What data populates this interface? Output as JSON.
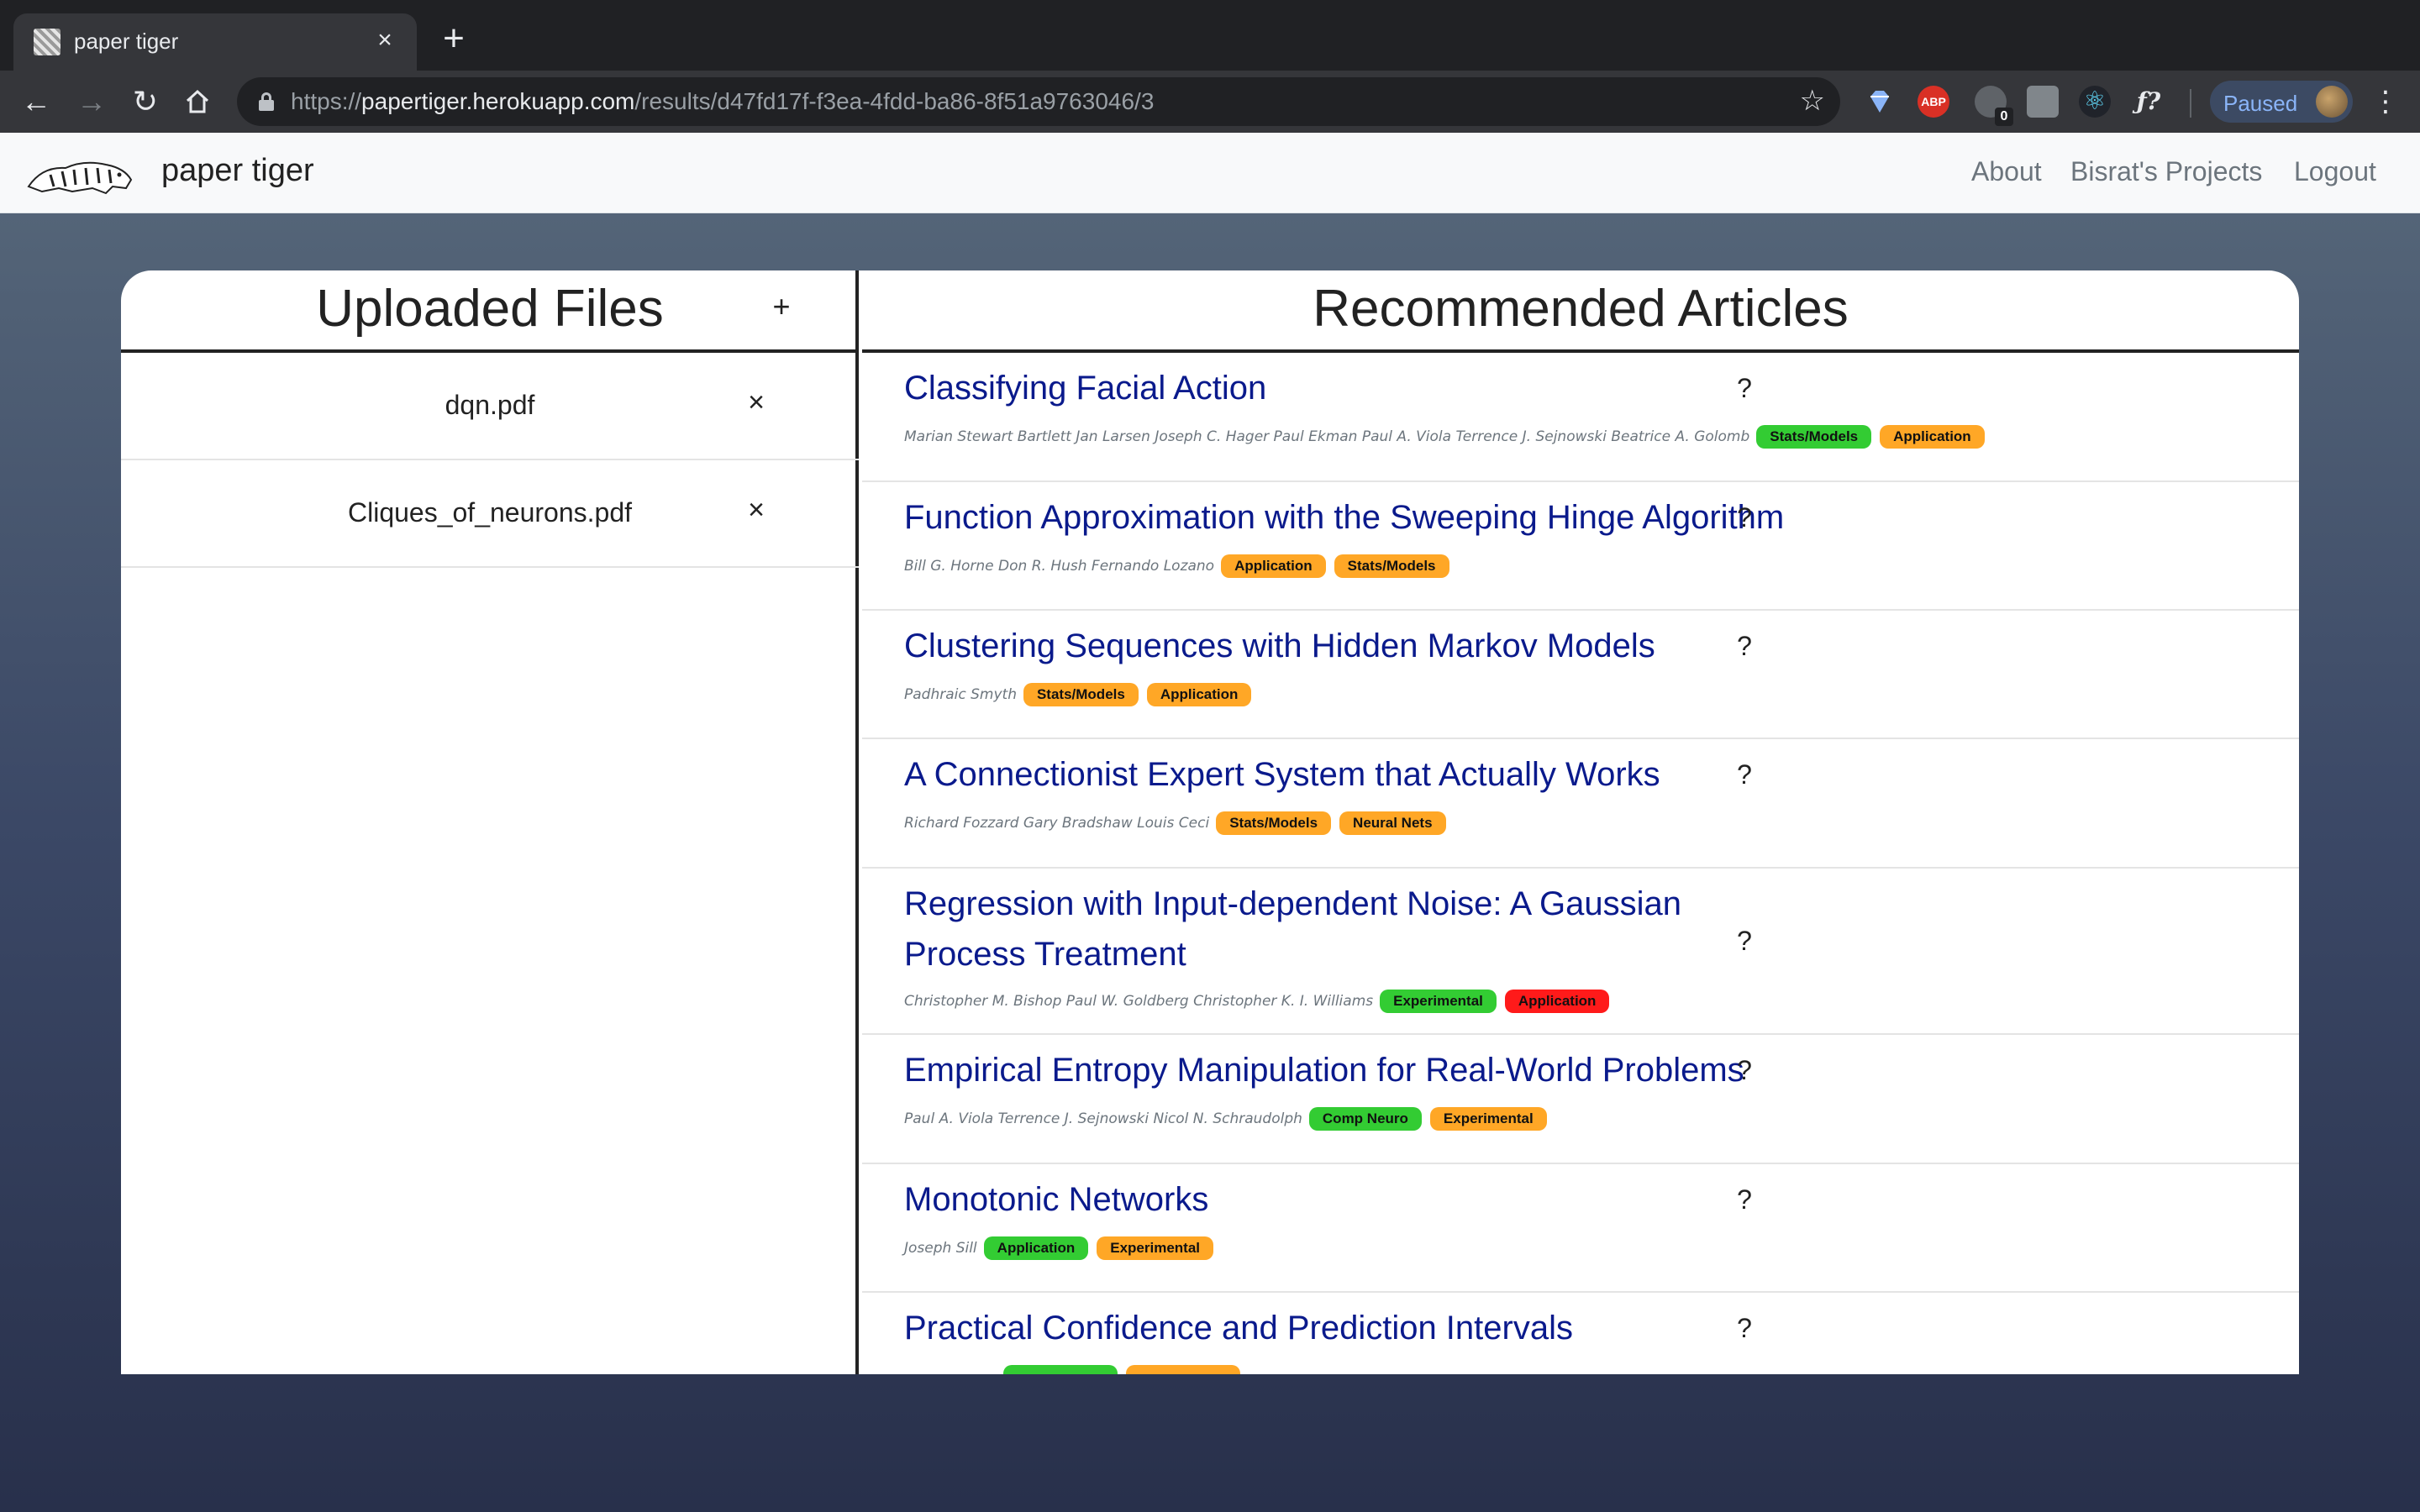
{
  "browser": {
    "tab_title": "paper tiger",
    "tab_close": "×",
    "new_tab": "+",
    "url_scheme": "https://",
    "url_host": "papertiger.herokuapp.com",
    "url_path": "/results/d47fd17f-f3ea-4fdd-ba86-8f51a9763046/3",
    "ext_abp": "ABP",
    "ext_badge": "0",
    "ext_f": "ƒ?",
    "profile_label": "Paused"
  },
  "navbar": {
    "brand": "paper tiger",
    "links": [
      "About",
      "Bisrat's Projects",
      "Logout"
    ]
  },
  "uploaded": {
    "title": "Uploaded Files",
    "add_label": "+",
    "remove_label": "×",
    "files": [
      "dqn.pdf",
      "Cliques_of_neurons.pdf"
    ]
  },
  "recommended": {
    "title": "Recommended Articles",
    "help_label": "?",
    "articles": [
      {
        "title": "Classifying Facial Action",
        "authors": "Marian Stewart Bartlett Jan Larsen Joseph C. Hager Paul Ekman Paul A. Viola Terrence J. Sejnowski Beatrice A. Golomb",
        "tags": [
          {
            "label": "Stats/Models",
            "color": "#33cc33"
          },
          {
            "label": "Application",
            "color": "#ffa726"
          }
        ]
      },
      {
        "title": "Function Approximation with the Sweeping Hinge Algorithm",
        "authors": "Bill G. Horne Don R. Hush Fernando Lozano",
        "tags": [
          {
            "label": "Application",
            "color": "#ffa726"
          },
          {
            "label": "Stats/Models",
            "color": "#ffa726"
          }
        ]
      },
      {
        "title": "Clustering Sequences with Hidden Markov Models",
        "authors": "Padhraic Smyth",
        "tags": [
          {
            "label": "Stats/Models",
            "color": "#ffa726"
          },
          {
            "label": "Application",
            "color": "#ffa726"
          }
        ]
      },
      {
        "title": "A Connectionist Expert System that Actually Works",
        "authors": "Richard Fozzard Gary Bradshaw Louis Ceci",
        "tags": [
          {
            "label": "Stats/Models",
            "color": "#ffa726"
          },
          {
            "label": "Neural Nets",
            "color": "#ffa726"
          }
        ]
      },
      {
        "title": "Regression with Input-dependent Noise: A Gaussian Process Treatment",
        "authors": "Christopher M. Bishop Paul W. Goldberg Christopher K. I. Williams",
        "tags": [
          {
            "label": "Experimental",
            "color": "#33cc33"
          },
          {
            "label": "Application",
            "color": "#ff1a1a"
          }
        ]
      },
      {
        "title": "Empirical Entropy Manipulation for Real-World Problems",
        "authors": "Paul A. Viola Terrence J. Sejnowski Nicol N. Schraudolph",
        "tags": [
          {
            "label": "Comp Neuro",
            "color": "#33cc33"
          },
          {
            "label": "Experimental",
            "color": "#ffa726"
          }
        ]
      },
      {
        "title": "Monotonic Networks",
        "authors": "Joseph Sill",
        "tags": [
          {
            "label": "Application",
            "color": "#33cc33"
          },
          {
            "label": "Experimental",
            "color": "#ffa726"
          }
        ]
      },
      {
        "title": "Practical Confidence and Prediction Intervals",
        "authors": "",
        "tags": [
          {
            "label": "",
            "color": "#33cc33"
          },
          {
            "label": "",
            "color": "#ffa726"
          }
        ]
      }
    ]
  }
}
